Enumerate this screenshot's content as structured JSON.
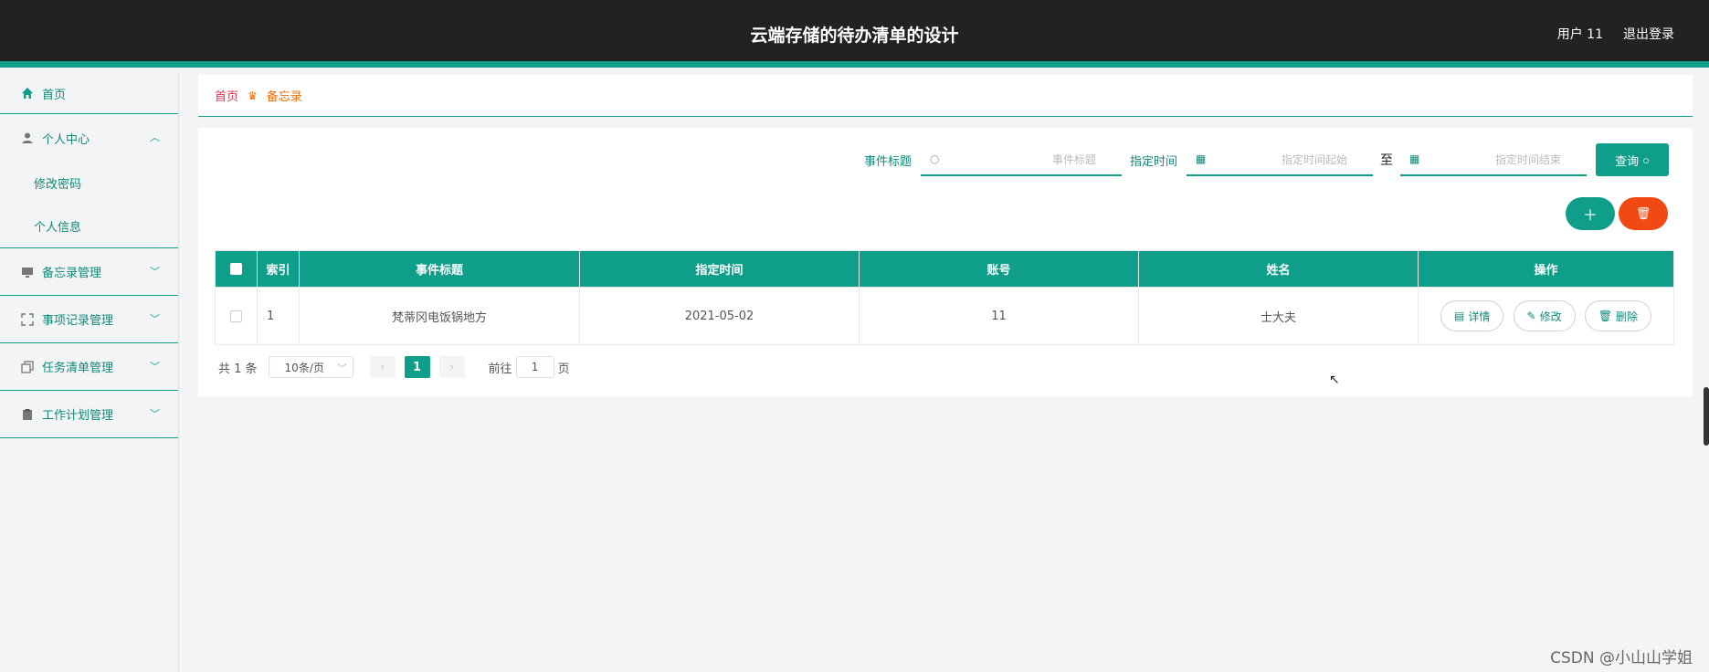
{
  "header": {
    "title": "云端存储的待办清单的设计",
    "user_label": "用户 11",
    "logout_label": "退出登录"
  },
  "sidebar": {
    "home": "首页",
    "personal_center": "个人中心",
    "change_password": "修改密码",
    "personal_info": "个人信息",
    "memo_manage": "备忘录管理",
    "event_manage": "事项记录管理",
    "task_manage": "任务清单管理",
    "work_plan_manage": "工作计划管理"
  },
  "breadcrumb": {
    "home": "首页",
    "current": "备忘录"
  },
  "search": {
    "title_label": "事件标题",
    "title_placeholder": "事件标题",
    "time_label": "指定时间",
    "start_placeholder": "指定时间起始",
    "to": "至",
    "end_placeholder": "指定时间结束",
    "query_button": "查询"
  },
  "actions": {
    "add_icon": "plus-icon",
    "delete_icon": "trash-icon"
  },
  "table": {
    "headers": [
      "索引",
      "事件标题",
      "指定时间",
      "账号",
      "姓名",
      "操作"
    ],
    "rows": [
      {
        "index": "1",
        "title": "梵蒂冈电饭锅地方",
        "time": "2021-05-02",
        "account": "11",
        "name": "士大夫",
        "ops": [
          "详情",
          "修改",
          "删除"
        ]
      }
    ]
  },
  "pagination": {
    "total": "共 1 条",
    "page_size": "10条/页",
    "current_page": "1",
    "goto_prefix": "前往",
    "goto_value": "1",
    "goto_suffix": "页"
  },
  "watermark": "CSDN @小山山学姐",
  "colors": {
    "accent": "#0e9e8a",
    "danger": "#f04a12",
    "header_bg": "#222222"
  }
}
